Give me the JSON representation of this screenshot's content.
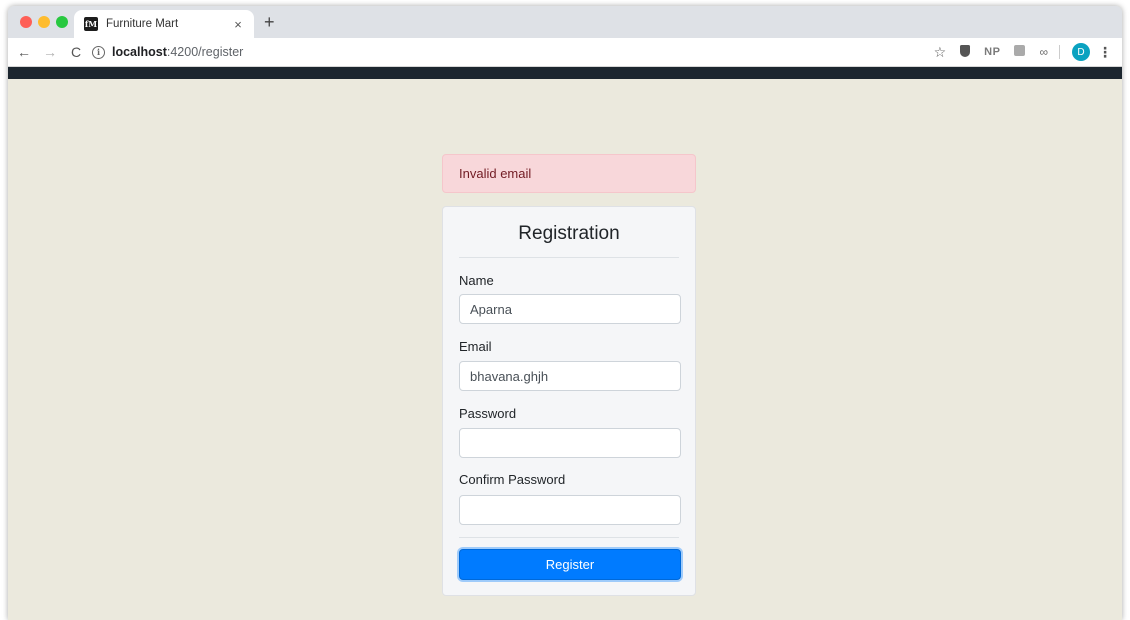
{
  "browser": {
    "tab": {
      "favicon_text": "fM",
      "title": "Furniture Mart",
      "close_glyph": "×"
    },
    "new_tab_glyph": "+",
    "nav": {
      "back": "←",
      "forward": "→",
      "reload": "C"
    },
    "url": {
      "host": "localhost",
      "path": ":4200/register"
    },
    "extensions": {
      "np_label": "NP"
    },
    "profile_initial": "D",
    "menu_glyph": "⋮"
  },
  "alert": {
    "message": "Invalid email"
  },
  "form": {
    "title": "Registration",
    "name": {
      "label": "Name",
      "value": "Aparna"
    },
    "email": {
      "label": "Email",
      "value": "bhavana.ghjh"
    },
    "password": {
      "label": "Password",
      "value": ""
    },
    "confirm_password": {
      "label": "Confirm Password",
      "value": ""
    },
    "submit_label": "Register"
  },
  "colors": {
    "page_background": "#ebe9dd",
    "navbar": "#1c262f",
    "alert_background": "#f8d7da",
    "alert_text": "#721c24",
    "primary_button": "#007bff"
  }
}
